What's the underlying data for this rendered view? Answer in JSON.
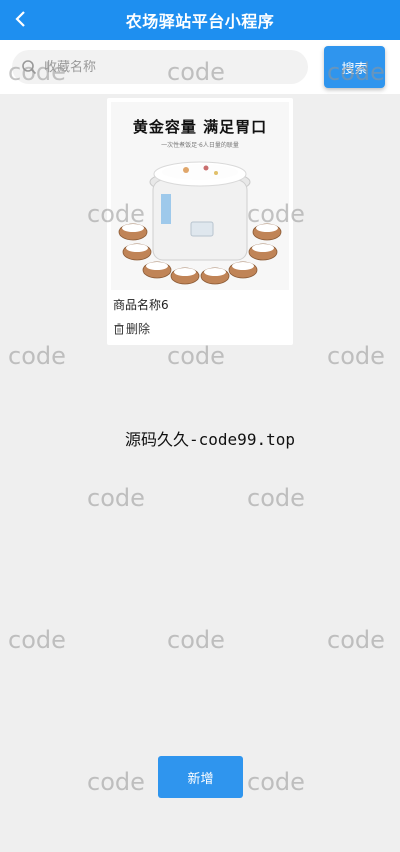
{
  "header": {
    "title": "农场驿站平台小程序"
  },
  "search": {
    "placeholder": "收藏名称",
    "button_label": "搜索"
  },
  "products": [
    {
      "image_headline": "黄金容量 满足胃口",
      "image_subtitle": "一次性煮饭足·6人日量的联量",
      "name": "商品名称6",
      "delete_label": "删除"
    }
  ],
  "footer": {
    "text": "源码久久-code99.top"
  },
  "actions": {
    "add_label": "新增"
  },
  "watermark": {
    "text": "code"
  },
  "colors": {
    "primary": "#1e8ff0",
    "button": "#2f95ee",
    "background": "#efefef"
  }
}
